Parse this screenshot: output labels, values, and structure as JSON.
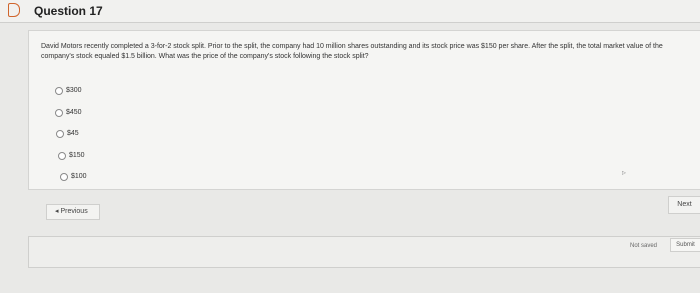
{
  "question": {
    "title": "Question 17",
    "text": "David Motors recently completed a 3-for-2 stock split. Prior to the split, the company had 10 million shares outstanding and its stock price was $150 per share. After the split, the total market value of the company's stock equaled $1.5 billion. What was the price of the company's stock following the stock split?"
  },
  "options": [
    {
      "label": "$300"
    },
    {
      "label": "$450"
    },
    {
      "label": "$45"
    },
    {
      "label": "$150"
    },
    {
      "label": "$100"
    }
  ],
  "navigation": {
    "previous_label": "Previous",
    "previous_icon": "triangle-left-icon",
    "next_label": "Next"
  },
  "footer": {
    "status": "Not saved",
    "submit_label": "Submit"
  },
  "colors": {
    "flag": "#d0652c",
    "page_bg": "#e9e9e7",
    "panel_bg": "#f5f5f3"
  }
}
